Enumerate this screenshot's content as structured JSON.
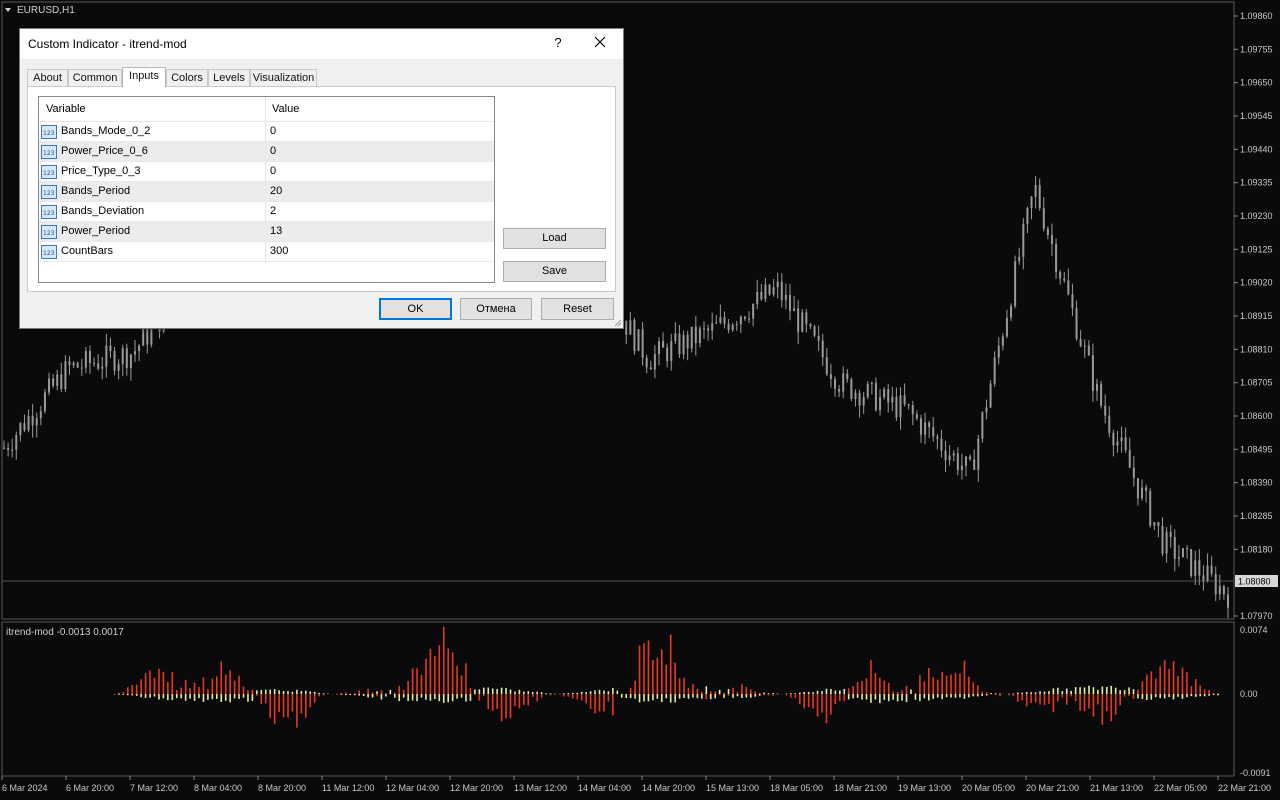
{
  "chart": {
    "title": "EURUSD,H1",
    "current_price": "1.08080",
    "price_ticks": [
      "1.09860",
      "1.09755",
      "1.09650",
      "1.09545",
      "1.09440",
      "1.09335",
      "1.09230",
      "1.09125",
      "1.09020",
      "1.08915",
      "1.08810",
      "1.08705",
      "1.08600",
      "1.08495",
      "1.08390",
      "1.08285",
      "1.08180",
      "1.07970"
    ],
    "time_ticks": [
      "6 Mar 2024",
      "6 Mar 20:00",
      "7 Mar 12:00",
      "8 Mar 04:00",
      "8 Mar 20:00",
      "11 Mar 12:00",
      "12 Mar 04:00",
      "12 Mar 20:00",
      "13 Mar 12:00",
      "14 Mar 04:00",
      "14 Mar 20:00",
      "15 Mar 13:00",
      "18 Mar 05:00",
      "18 Mar 21:00",
      "19 Mar 13:00",
      "20 Mar 05:00",
      "20 Mar 21:00",
      "21 Mar 13:00",
      "22 Mar 05:00",
      "22 Mar 21:00"
    ],
    "colors": {
      "background": "#0a0a0c",
      "candle": "#9a9a9a",
      "hist_up": "#e53a22",
      "hist_down": "#e8e8a8",
      "grid": "#3a3a3a"
    }
  },
  "indicator": {
    "label": "itrend-mod -0.0013 0.0017",
    "ticks": [
      "0.0074",
      "0.00",
      "-0.0091"
    ]
  },
  "chart_data": {
    "type": "line",
    "title": "EURUSD,H1",
    "xlabel": "",
    "ylabel": "",
    "ylim": [
      1.0797,
      1.0986
    ],
    "x": [
      "6 Mar 2024",
      "6 Mar 20:00",
      "7 Mar 12:00",
      "8 Mar 04:00",
      "8 Mar 20:00",
      "11 Mar 12:00",
      "12 Mar 04:00",
      "12 Mar 20:00",
      "13 Mar 12:00",
      "14 Mar 04:00",
      "14 Mar 20:00",
      "15 Mar 13:00",
      "18 Mar 05:00",
      "18 Mar 21:00",
      "19 Mar 13:00",
      "20 Mar 05:00",
      "20 Mar 21:00",
      "21 Mar 13:00",
      "22 Mar 05:00",
      "22 Mar 21:00"
    ],
    "series": [
      {
        "values": [
          1.085,
          1.0875,
          1.088,
          1.0905,
          1.0918,
          1.0905,
          1.0902,
          1.0898,
          1.0897,
          1.091,
          1.0878,
          1.0887,
          1.09,
          1.087,
          1.0862,
          1.0842,
          1.0932,
          1.0865,
          1.082,
          1.0804
        ]
      }
    ]
  },
  "dialog": {
    "title": "Custom Indicator - itrend-mod",
    "help": "?",
    "tabs": [
      "About",
      "Common",
      "Inputs",
      "Colors",
      "Levels",
      "Visualization"
    ],
    "active_tab": "Inputs",
    "columns": {
      "variable": "Variable",
      "value": "Value"
    },
    "params": [
      {
        "name": "Bands_Mode_0_2",
        "value": "0"
      },
      {
        "name": "Power_Price_0_6",
        "value": "0"
      },
      {
        "name": "Price_Type_0_3",
        "value": "0"
      },
      {
        "name": "Bands_Period",
        "value": "20"
      },
      {
        "name": "Bands_Deviation",
        "value": "2"
      },
      {
        "name": "Power_Period",
        "value": "13"
      },
      {
        "name": "CountBars",
        "value": "300"
      }
    ],
    "load": "Load",
    "save": "Save",
    "ok": "OK",
    "cancel": "Отмена",
    "reset": "Reset"
  }
}
